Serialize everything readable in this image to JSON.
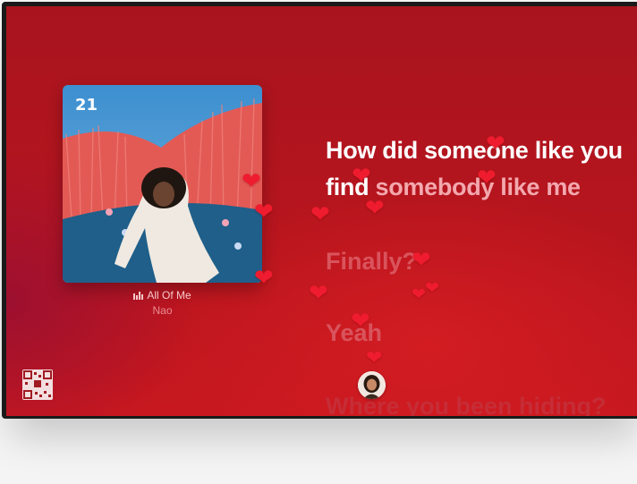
{
  "now_playing": {
    "album_badge": "21",
    "title": "All Of Me",
    "artist": "Nao",
    "bars_icon": "audio-bars-icon"
  },
  "lyrics": {
    "line1": "How did someone like you",
    "line2_bright": "find ",
    "line2_dim": "somebody like me",
    "line3": "Finally?",
    "line4": "Yeah",
    "line5": "Where you been hiding?"
  },
  "reaction": {
    "icon": "heart-icon",
    "glyph": "❤"
  },
  "colors": {
    "background": "#b8151e",
    "heart": "#ee1c2e",
    "lyric_active": "#ffffff",
    "lyric_upcoming": "#d9545c"
  }
}
